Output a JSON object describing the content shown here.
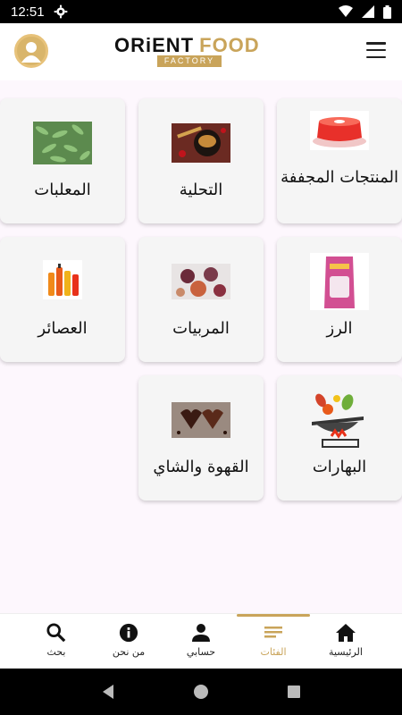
{
  "status": {
    "time": "12:51"
  },
  "header": {
    "logo_main": "ORiENT",
    "logo_accent": "FOOD",
    "logo_sub": "FACTORY"
  },
  "categories": [
    {
      "label": "المنتجات المجففة",
      "icon": "dried-jelly-cake-image"
    },
    {
      "label": "التحلية",
      "icon": "dessert-bowl-image"
    },
    {
      "label": "المعلبات",
      "icon": "canned-beans-image"
    },
    {
      "label": "الرز",
      "icon": "rice-bag-image"
    },
    {
      "label": "المربيات",
      "icon": "jam-figs-image"
    },
    {
      "label": "العصائر",
      "icon": "juice-bottles-image"
    },
    {
      "label": "البهارات",
      "icon": "spices-pan-image"
    },
    {
      "label": "القهوة والشاي",
      "icon": "coffee-beans-image"
    }
  ],
  "bottom_nav": [
    {
      "label": "الرئيسية",
      "icon": "home-icon"
    },
    {
      "label": "الفئات",
      "icon": "list-icon",
      "active": true
    },
    {
      "label": "حسابي",
      "icon": "person-icon"
    },
    {
      "label": "من نحن",
      "icon": "info-icon"
    },
    {
      "label": "بحث",
      "icon": "search-icon"
    }
  ],
  "colors": {
    "accent": "#c9a45a",
    "background": "#fdf7fd",
    "card": "#f5f5f5"
  }
}
